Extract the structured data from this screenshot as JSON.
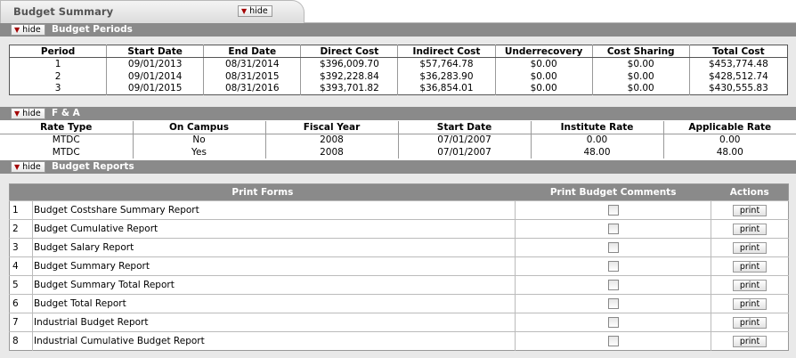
{
  "tab": {
    "title": "Budget Summary",
    "hide_label": "hide"
  },
  "periods_section": {
    "title": "Budget Periods",
    "hide_label": "hide",
    "headers": [
      "Period",
      "Start Date",
      "End Date",
      "Direct Cost",
      "Indirect Cost",
      "Underrecovery",
      "Cost Sharing",
      "Total Cost"
    ],
    "rows": [
      [
        "1",
        "09/01/2013",
        "08/31/2014",
        "$396,009.70",
        "$57,764.78",
        "$0.00",
        "$0.00",
        "$453,774.48"
      ],
      [
        "2",
        "09/01/2014",
        "08/31/2015",
        "$392,228.84",
        "$36,283.90",
        "$0.00",
        "$0.00",
        "$428,512.74"
      ],
      [
        "3",
        "09/01/2015",
        "08/31/2016",
        "$393,701.82",
        "$36,854.01",
        "$0.00",
        "$0.00",
        "$430,555.83"
      ]
    ]
  },
  "fa_section": {
    "title": "F & A",
    "hide_label": "hide",
    "headers": [
      "Rate Type",
      "On Campus",
      "Fiscal Year",
      "Start Date",
      "Institute Rate",
      "Applicable Rate"
    ],
    "rows": [
      [
        "MTDC",
        "No",
        "2008",
        "07/01/2007",
        "0.00",
        "0.00"
      ],
      [
        "MTDC",
        "Yes",
        "2008",
        "07/01/2007",
        "48.00",
        "48.00"
      ]
    ]
  },
  "reports_section": {
    "title": "Budget Reports",
    "hide_label": "hide",
    "headers": {
      "print_forms": "Print Forms",
      "comments": "Print Budget Comments",
      "actions": "Actions"
    },
    "print_label": "print",
    "rows": [
      {
        "num": "1",
        "name": "Budget Costshare Summary Report"
      },
      {
        "num": "2",
        "name": "Budget Cumulative Report"
      },
      {
        "num": "3",
        "name": "Budget Salary Report"
      },
      {
        "num": "4",
        "name": "Budget Summary Report"
      },
      {
        "num": "5",
        "name": "Budget Summary Total Report"
      },
      {
        "num": "6",
        "name": "Budget Total Report"
      },
      {
        "num": "7",
        "name": "Industrial Budget Report"
      },
      {
        "num": "8",
        "name": "Industrial Cumulative Budget Report"
      }
    ]
  }
}
